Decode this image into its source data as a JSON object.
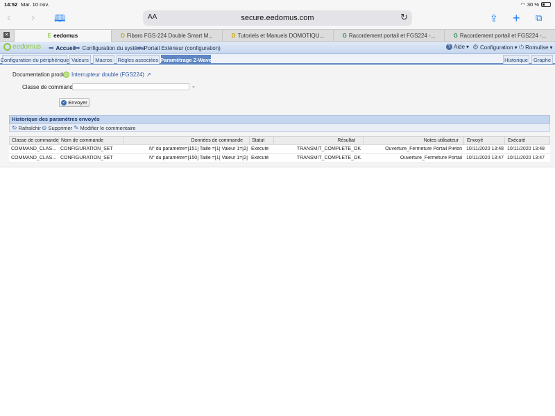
{
  "status_bar": {
    "time": "14:52",
    "date": "Mar. 10 nov.",
    "battery": "30 %"
  },
  "safari": {
    "text_size_label": "AA",
    "address": "secure.eedomus.com",
    "icons": [
      "back-icon",
      "forward-icon",
      "bookmarks-icon",
      "reload-icon",
      "share-icon",
      "new-tab-icon",
      "tabs-icon"
    ],
    "tabs": [
      {
        "label": "eedomus",
        "icon": "E",
        "icon_class": "ico-e"
      },
      {
        "label": "Fibaro FGS-224 Double Smart M...",
        "icon": "D",
        "icon_class": "ico-d"
      },
      {
        "label": "Tutoriels et Manuels DOMOTIQU...",
        "icon": "D",
        "icon_class": "ico-d"
      },
      {
        "label": "Racordement portail et FGS224 -...",
        "icon": "G",
        "icon_class": "ico-g"
      },
      {
        "label": "Racordement portail et FGS224 -...",
        "icon": "G",
        "icon_class": "ico-g"
      }
    ]
  },
  "app_header": {
    "logo": "eedomus",
    "breadcrumb": [
      "Accueil",
      "Configuration du système",
      "Portail Extérieur (configuration)"
    ],
    "aide": "Aide",
    "configuration": "Configuration",
    "user": "Romulise"
  },
  "page_tabs": {
    "left": [
      "Configuration du périphérique",
      "Valeurs",
      "Macros",
      "Règles associées",
      "Paramétrage Z-Wave"
    ],
    "active": "Paramétrage Z-Wave",
    "right": [
      "Historique",
      "Graphe"
    ]
  },
  "form": {
    "doc_label": "Documentation produit",
    "doc_link": "Interrupteur double (FGS224)",
    "classe_label": "Classe de commande",
    "classe_value": "",
    "send_button": "Envoyer"
  },
  "history": {
    "title": "Historique des paramètres envoyés",
    "toolbar": {
      "refresh": "Rafraîchir",
      "delete": "Supprimer",
      "edit_comment": "Modifier le commentaire"
    },
    "columns": [
      "Classe de commande",
      "Nom de commande",
      "Données de commande",
      "Statut",
      "Résultat",
      "Notes utilisateur",
      "Envoyé",
      "Exécuté"
    ],
    "rows": [
      [
        "COMMAND_CLAS...",
        "CONFIGURATION_SET",
        "N° du paramètre=[151] Taille =[1] Valeur 1=[2]",
        "Exécuté",
        "TRANSMIT_COMPLETE_OK",
        "Ouverture_Fermeture Portail Piéton",
        "10/11/2020 13:48",
        "10/11/2020 13:48"
      ],
      [
        "COMMAND_CLAS...",
        "CONFIGURATION_SET",
        "N° du paramètre=[150] Taille =[1] Valeur 1=[2]",
        "Exécuté",
        "TRANSMIT_COMPLETE_OK",
        "Ouverture_Fermeture Portail",
        "10/11/2020 13:47",
        "10/11/2020 13:47"
      ]
    ]
  }
}
